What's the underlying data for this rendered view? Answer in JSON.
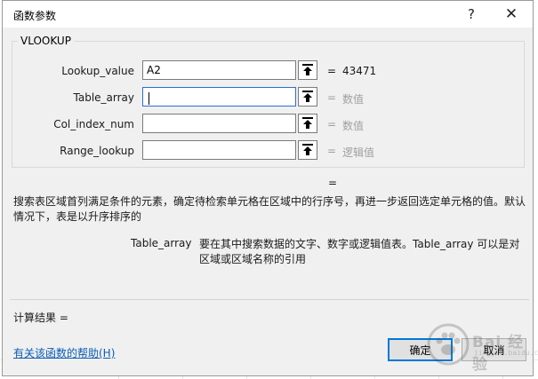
{
  "dialog": {
    "title": "函数参数",
    "help_button": "?",
    "close_button": "✕",
    "function_name": "VLOOKUP"
  },
  "arguments": [
    {
      "label": "Lookup_value",
      "value": "A2",
      "eq": "=",
      "result": "43471",
      "muted": false
    },
    {
      "label": "Table_array",
      "value": "",
      "eq": "=",
      "result": "数值",
      "muted": true
    },
    {
      "label": "Col_index_num",
      "value": "",
      "eq": "=",
      "result": "数值",
      "muted": true
    },
    {
      "label": "Range_lookup",
      "value": "",
      "eq": "=",
      "result": "逻辑值",
      "muted": true
    }
  ],
  "result_eq": "=",
  "description": "搜索表区域首列满足条件的元素，确定待检索单元格在区域中的行序号，再进一步返回选定单元格的值。默认情况下，表是以升序排序的",
  "arg_help": {
    "name": "Table_array",
    "text": "要在其中搜索数据的文字、数字或逻辑值表。Table_array 可以是对区域或区域名称的引用"
  },
  "calc_result": "计算结果 =",
  "help_link": "有关该函数的帮助(H)",
  "buttons": {
    "ok": "确定",
    "cancel": "取消"
  },
  "watermark": {
    "text": "Bai 经验",
    "sub": "jingyan.baidu.com"
  },
  "icons": {
    "collapse": "collapse-dialog-icon"
  },
  "colors": {
    "link": "#0b5db4",
    "focus": "#2b6fd0",
    "default_button_border": "#0078d7"
  }
}
